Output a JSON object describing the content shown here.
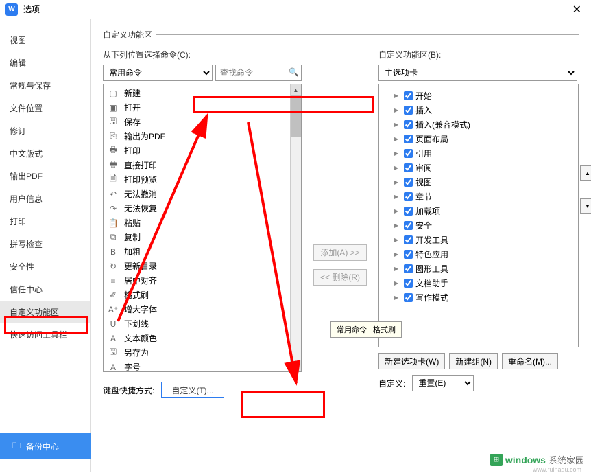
{
  "window": {
    "title": "选项"
  },
  "sidebar": {
    "items": [
      "视图",
      "编辑",
      "常规与保存",
      "文件位置",
      "修订",
      "中文版式",
      "输出PDF",
      "用户信息",
      "打印",
      "拼写检查",
      "安全性",
      "信任中心",
      "自定义功能区",
      "快速访问工具栏"
    ],
    "active_index": 12,
    "backup": "备份中心"
  },
  "section": {
    "title": "自定义功能区"
  },
  "left_panel": {
    "label": "从下列位置选择命令(C):",
    "combo": "常用命令",
    "search_placeholder": "查找命令",
    "items": [
      {
        "icon": "▢",
        "label": "新建",
        "arr": false
      },
      {
        "icon": "▣",
        "label": "打开",
        "arr": false
      },
      {
        "icon": "🖫",
        "label": "保存",
        "arr": false
      },
      {
        "icon": "⎘",
        "label": "输出为PDF",
        "arr": false
      },
      {
        "icon": "🖶",
        "label": "打印",
        "arr": false
      },
      {
        "icon": "🖶",
        "label": "直接打印",
        "arr": false
      },
      {
        "icon": "🗎",
        "label": "打印预览",
        "arr": false
      },
      {
        "icon": "↶",
        "label": "无法撤消",
        "arr": true
      },
      {
        "icon": "↷",
        "label": "无法恢复",
        "arr": false
      },
      {
        "icon": "📋",
        "label": "粘贴",
        "arr": false
      },
      {
        "icon": "⧉",
        "label": "复制",
        "arr": false
      },
      {
        "icon": "B",
        "label": "加粗",
        "arr": false
      },
      {
        "icon": "↻",
        "label": "更新目录",
        "arr": false
      },
      {
        "icon": "≡",
        "label": "居中对齐",
        "arr": false
      },
      {
        "icon": "✐",
        "label": "格式刷",
        "arr": true
      },
      {
        "icon": "A⁺",
        "label": "增大字体",
        "arr": false
      },
      {
        "icon": "U",
        "label": "下划线",
        "arr": true
      },
      {
        "icon": "A",
        "label": "文本颜色",
        "arr": true
      },
      {
        "icon": "🖫",
        "label": "另存为",
        "arr": true
      },
      {
        "icon": "A",
        "label": "字号",
        "arr": true
      }
    ]
  },
  "mid": {
    "add": "添加(A) >>",
    "remove": "<< 删除(R)"
  },
  "right_panel": {
    "label": "自定义功能区(B):",
    "combo": "主选项卡",
    "items": [
      "开始",
      "插入",
      "插入(兼容模式)",
      "页面布局",
      "引用",
      "审阅",
      "视图",
      "章节",
      "加载项",
      "安全",
      "开发工具",
      "特色应用",
      "图形工具",
      "文档助手",
      "写作模式"
    ]
  },
  "bottom": {
    "new_tab": "新建选项卡(W)",
    "new_group": "新建组(N)",
    "rename": "重命名(M)...",
    "custom_label": "自定义:",
    "reset": "重置(E)",
    "kbd_label": "键盘快捷方式:",
    "kbd_btn": "自定义(T)..."
  },
  "tooltip": "常用命令 | 格式刷",
  "watermark": {
    "brand": "windows",
    "suffix": "系统家园",
    "sub": "www.ruinadu.com"
  }
}
